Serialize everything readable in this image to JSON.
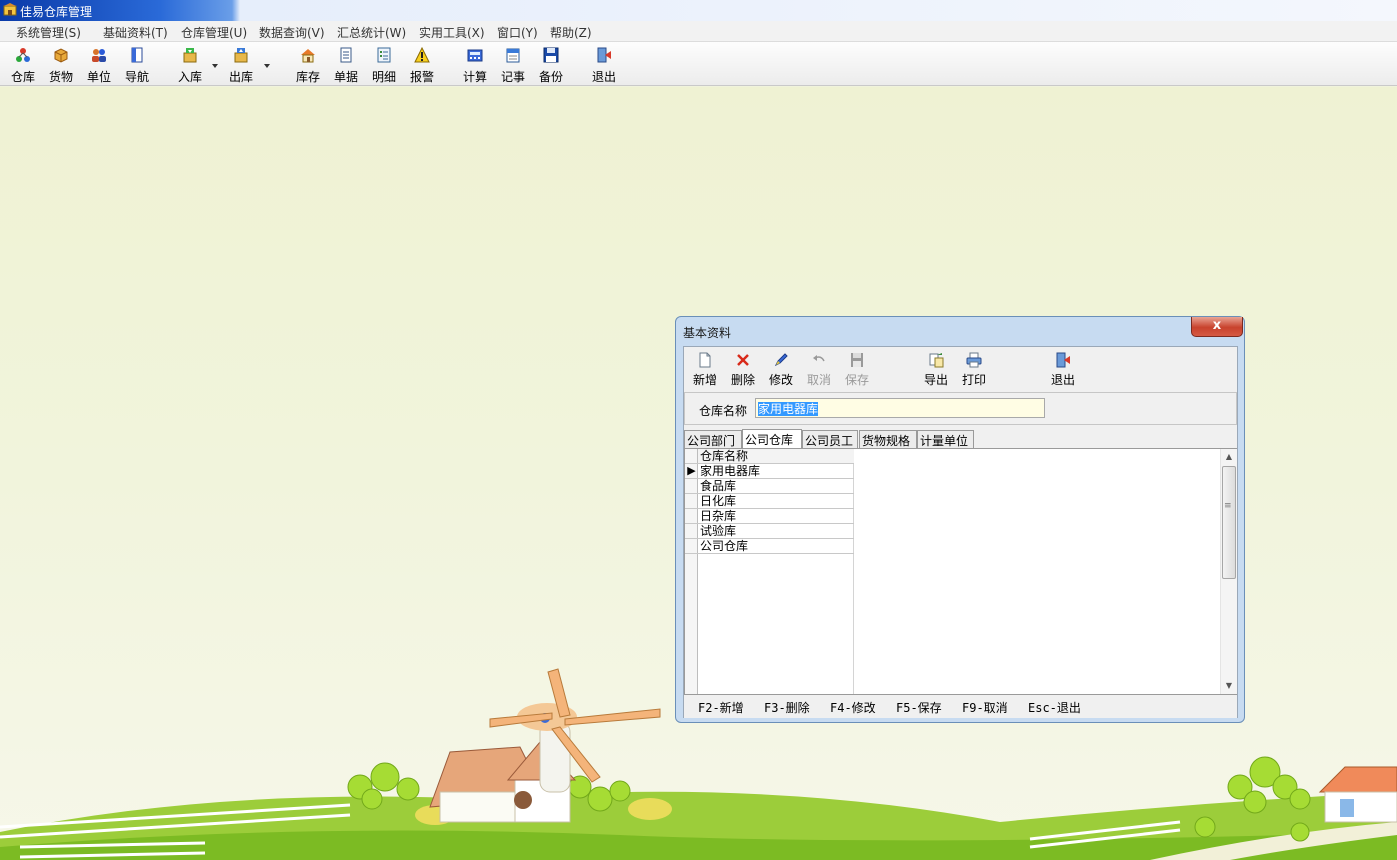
{
  "app": {
    "title": "佳易仓库管理",
    "icon": "app-icon"
  },
  "menu": {
    "items": [
      {
        "label": "系统管理(S)"
      },
      {
        "label": "基础资料(T)"
      },
      {
        "label": "仓库管理(U)"
      },
      {
        "label": "数据查询(V)"
      },
      {
        "label": "汇总统计(W)"
      },
      {
        "label": "实用工具(X)"
      },
      {
        "label": "窗口(Y)"
      },
      {
        "label": "帮助(Z)"
      }
    ]
  },
  "toolbar": {
    "buttons": [
      {
        "label": "仓库",
        "icon": "warehouse-icon"
      },
      {
        "label": "货物",
        "icon": "goods-box-icon"
      },
      {
        "label": "单位",
        "icon": "users-icon"
      },
      {
        "label": "导航",
        "icon": "navigation-icon"
      },
      {
        "label": "入库",
        "icon": "stock-in-icon",
        "dropdown": true
      },
      {
        "label": "出库",
        "icon": "stock-out-icon",
        "dropdown": true
      },
      {
        "label": "库存",
        "icon": "inventory-house-icon"
      },
      {
        "label": "单据",
        "icon": "document-icon"
      },
      {
        "label": "明细",
        "icon": "detail-list-icon"
      },
      {
        "label": "报警",
        "icon": "warning-icon"
      },
      {
        "label": "计算",
        "icon": "calculator-icon"
      },
      {
        "label": "记事",
        "icon": "notepad-icon"
      },
      {
        "label": "备份",
        "icon": "floppy-disk-icon"
      },
      {
        "label": "退出",
        "icon": "exit-door-icon"
      }
    ]
  },
  "dialog": {
    "title": "基本资料",
    "close_label": "x",
    "toolbar": [
      {
        "label": "新增",
        "icon": "new-file-icon",
        "enabled": true
      },
      {
        "label": "删除",
        "icon": "delete-x-icon",
        "enabled": true
      },
      {
        "label": "修改",
        "icon": "edit-pen-icon",
        "enabled": true
      },
      {
        "label": "取消",
        "icon": "undo-icon",
        "enabled": false
      },
      {
        "label": "保存",
        "icon": "save-icon",
        "enabled": false
      },
      {
        "label": "导出",
        "icon": "export-icon",
        "enabled": true
      },
      {
        "label": "打印",
        "icon": "printer-icon",
        "enabled": true
      },
      {
        "label": "退出",
        "icon": "exit-door-icon",
        "enabled": true
      }
    ],
    "field": {
      "label": "仓库名称",
      "value": "家用电器库"
    },
    "tabs": [
      {
        "label": "公司部门",
        "active": false
      },
      {
        "label": "公司仓库",
        "active": true
      },
      {
        "label": "公司员工",
        "active": false
      },
      {
        "label": "货物规格",
        "active": false
      },
      {
        "label": "计量单位",
        "active": false
      }
    ],
    "grid": {
      "header": "仓库名称",
      "rows": [
        "家用电器库",
        "食品库",
        "日化库",
        "日杂库",
        "试验库",
        "公司仓库"
      ],
      "current_row_indicator": "▶"
    },
    "hotkeys": [
      {
        "label": "F2-新增"
      },
      {
        "label": "F3-删除"
      },
      {
        "label": "F4-修改"
      },
      {
        "label": "F5-保存"
      },
      {
        "label": "F9-取消"
      },
      {
        "label": "Esc-退出"
      }
    ]
  },
  "colors": {
    "titlebar": "#0a3aa8",
    "desktop_bg": "#f0f3dc",
    "dialog_frame": "#c7dbf1",
    "close_button": "#c8422d",
    "selection": "#3399ff",
    "input_bg": "#fffde4"
  }
}
